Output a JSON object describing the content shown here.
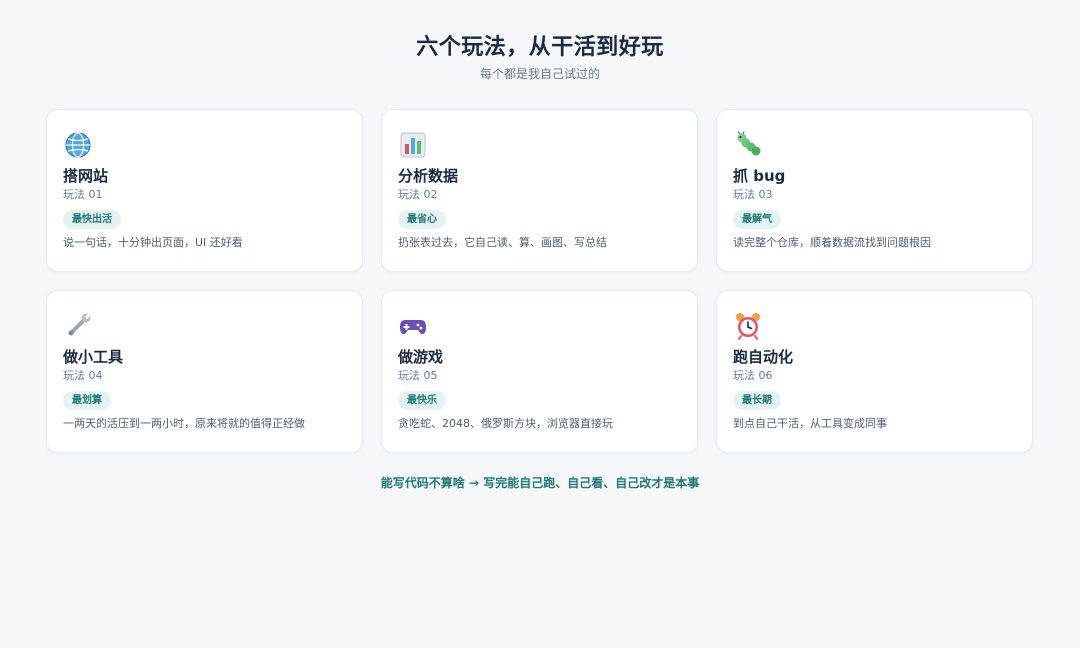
{
  "header": {
    "title": "六个玩法，从干活到好玩",
    "subtitle": "每个都是我自己试过的"
  },
  "cards": [
    {
      "icon": "globe-icon",
      "title": "搭网站",
      "number": "玩法 01",
      "tag": "最快出活",
      "desc": "说一句话，十分钟出页面，UI 还好看"
    },
    {
      "icon": "bar-chart-icon",
      "title": "分析数据",
      "number": "玩法 02",
      "tag": "最省心",
      "desc": "扔张表过去，它自己读、算、画图、写总结"
    },
    {
      "icon": "bug-icon",
      "title": "抓 bug",
      "number": "玩法 03",
      "tag": "最解气",
      "desc": "读完整个仓库，顺着数据流找到问题根因"
    },
    {
      "icon": "wrench-icon",
      "title": "做小工具",
      "number": "玩法 04",
      "tag": "最划算",
      "desc": "一两天的活压到一两小时，原来将就的值得正经做"
    },
    {
      "icon": "gamepad-icon",
      "title": "做游戏",
      "number": "玩法 05",
      "tag": "最快乐",
      "desc": "贪吃蛇、2048、俄罗斯方块，浏览器直接玩"
    },
    {
      "icon": "alarm-clock-icon",
      "title": "跑自动化",
      "number": "玩法 06",
      "tag": "最长期",
      "desc": "到点自己干活，从工具变成同事"
    }
  ],
  "footer": {
    "text": "能写代码不算啥 → 写完能自己跑、自己看、自己改才是本事"
  },
  "colors": {
    "background": "#f5f7fb",
    "accent": "#1f7a73",
    "tag_background": "#e3f3f1",
    "title": "#1b2a41"
  }
}
